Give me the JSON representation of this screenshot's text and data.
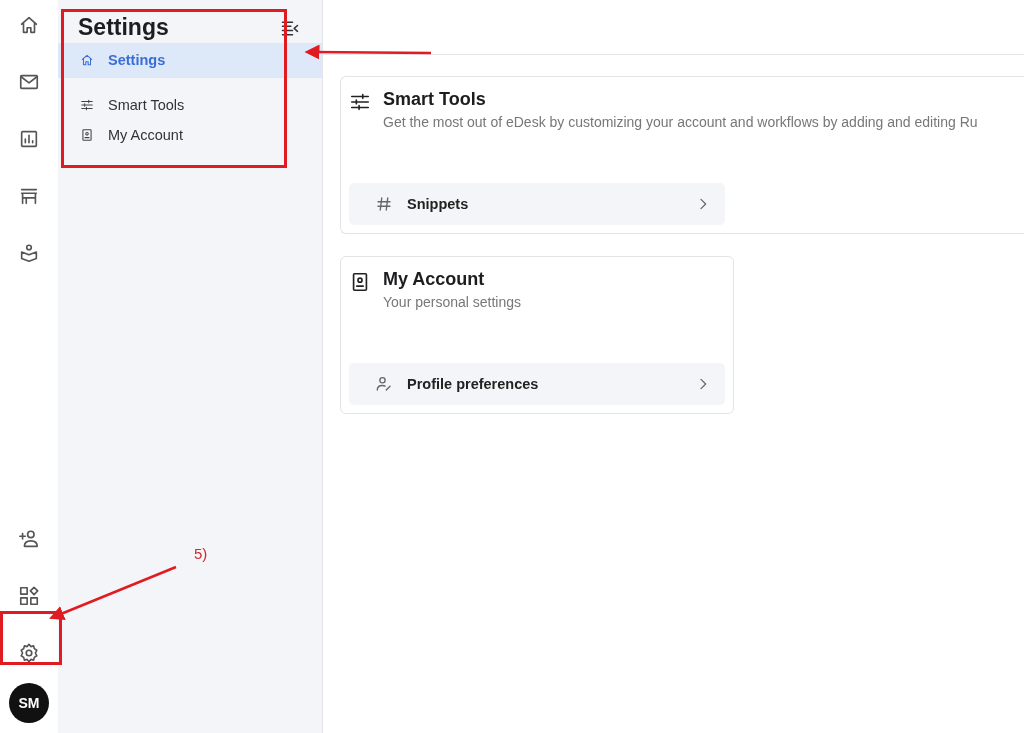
{
  "rail": {
    "avatar": "SM"
  },
  "sidebar": {
    "title": "Settings",
    "items": [
      {
        "label": "Settings",
        "selected": true
      },
      {
        "label": "Smart Tools",
        "selected": false
      },
      {
        "label": "My Account",
        "selected": false
      }
    ]
  },
  "cards": [
    {
      "title": "Smart Tools",
      "description": "Get the most out of eDesk by customizing your account and workflows by adding and editing Ru",
      "links": [
        {
          "label": "Snippets"
        }
      ]
    },
    {
      "title": "My Account",
      "description": "Your personal settings",
      "links": [
        {
          "label": "Profile preferences"
        }
      ]
    }
  ],
  "annotations": {
    "step_label": "5)"
  }
}
